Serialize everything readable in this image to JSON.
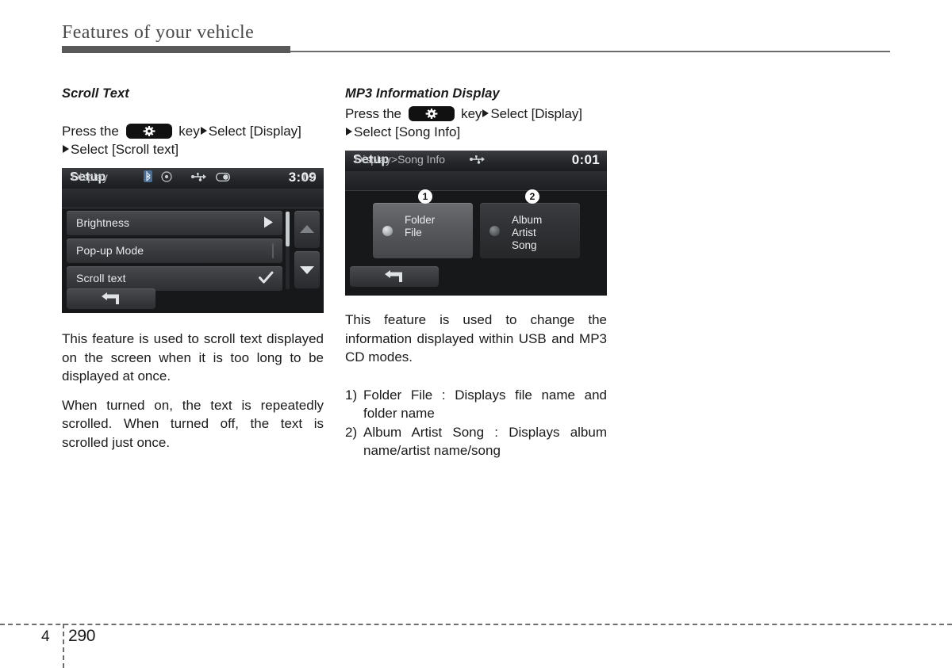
{
  "header": {
    "title": "Features of your vehicle"
  },
  "left_column": {
    "heading": "Scroll Text",
    "instruction": {
      "prefix": "Press the",
      "key_icon": "gear-key-icon",
      "mid": "key",
      "step1": "Select [Display]",
      "step2": "Select [Scroll text]"
    },
    "screen": {
      "title": "Setup",
      "clock": "3:09",
      "status_icons": [
        "bluetooth-icon",
        "disc-icon",
        "usb-icon",
        "device-icon"
      ],
      "breadcrumb": "Display",
      "page_indicator": "1/2",
      "rows": [
        {
          "label": "Brightness",
          "indicator": "arrow-right-icon"
        },
        {
          "label": "Pop-up Mode",
          "indicator": "checkbox-empty-icon"
        },
        {
          "label": "Scroll text",
          "indicator": "checkmark-icon"
        }
      ],
      "nav_up": "scroll-up-icon",
      "nav_down": "scroll-down-icon",
      "back": "back-arrow-icon"
    },
    "paragraphs": [
      "This feature is used to scroll text displayed on the screen when it is too long to be displayed at once.",
      "When turned on, the text is repeatedly scrolled. When turned off, the text is scrolled just once."
    ]
  },
  "right_column": {
    "heading": "MP3 Information Display",
    "instruction": {
      "prefix": "Press the",
      "key_icon": "gear-key-icon",
      "mid": "key",
      "step1": "Select [Display]",
      "step2": "Select [Song Info]"
    },
    "screen": {
      "title": "Setup",
      "clock": "0:01",
      "status_icons": [
        "usb-icon"
      ],
      "breadcrumb": "Display>Song Info",
      "options": [
        {
          "callout": "1",
          "lines": [
            "Folder",
            "File"
          ],
          "selected": true
        },
        {
          "callout": "2",
          "lines": [
            "Album",
            "Artist",
            "Song"
          ],
          "selected": false
        }
      ],
      "back": "back-arrow-icon"
    },
    "paragraphs": [
      "This feature is used to change the information displayed within USB and MP3 CD modes."
    ],
    "numbered_items": [
      {
        "marker": "1)",
        "text": "Folder File : Displays file name and folder name"
      },
      {
        "marker": "2)",
        "text": "Album Artist Song : Displays album name/artist name/song"
      }
    ]
  },
  "footer": {
    "chapter": "4",
    "page_number": "290"
  }
}
